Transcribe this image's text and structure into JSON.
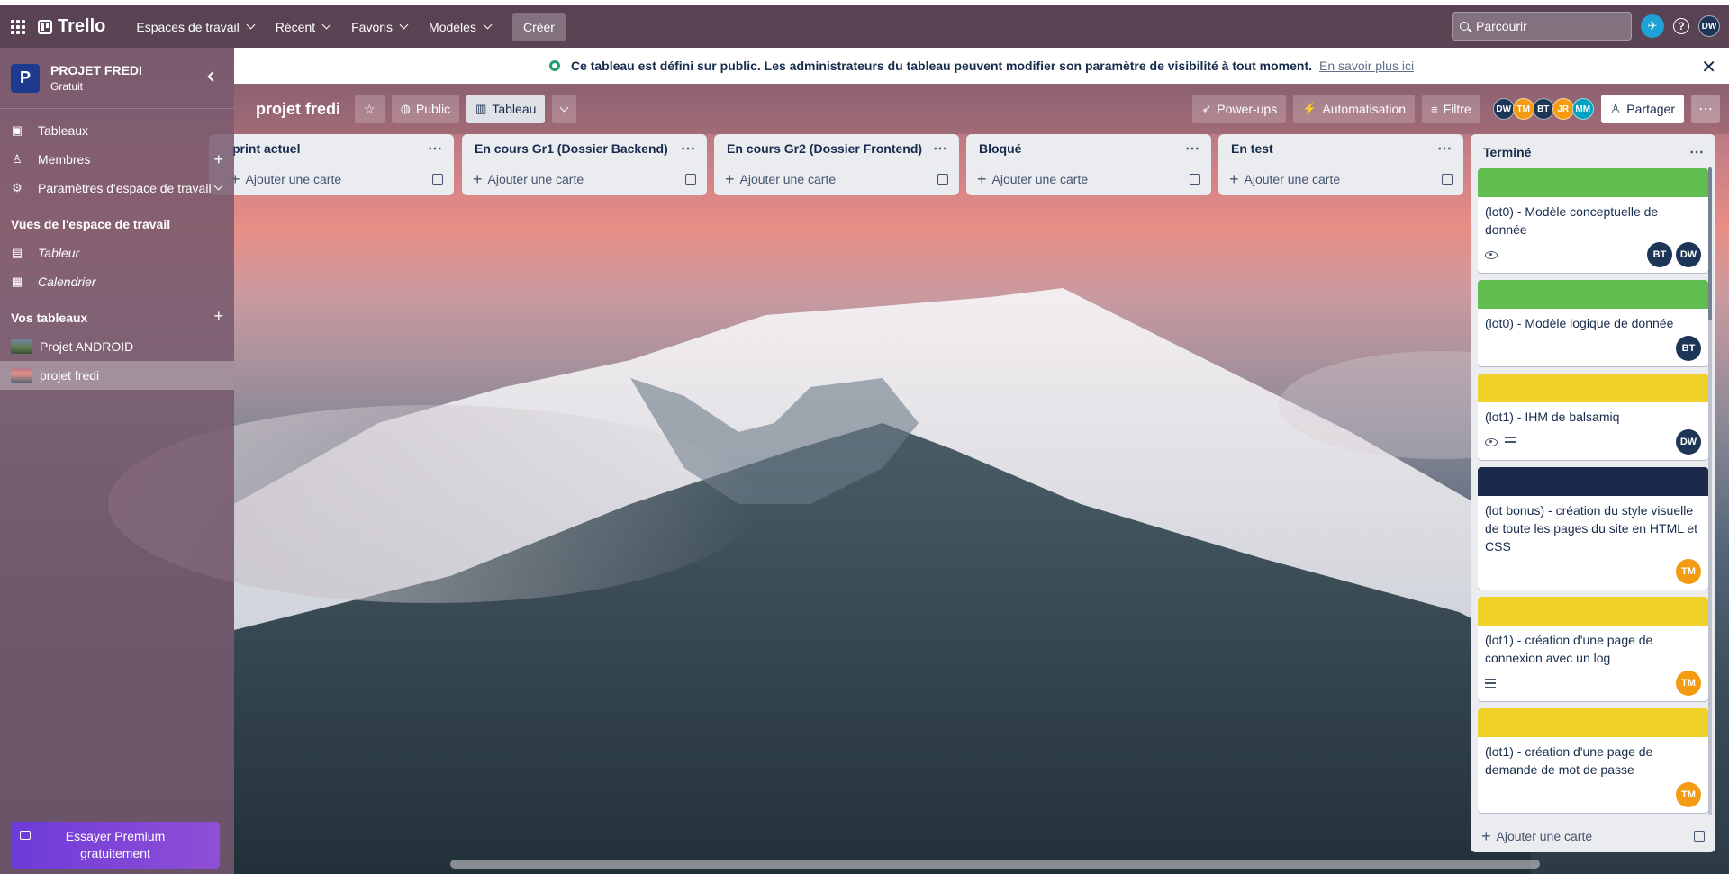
{
  "topbar": {
    "app_name": "Trello",
    "nav": [
      {
        "label": "Espaces de travail"
      },
      {
        "label": "Récent"
      },
      {
        "label": "Favoris"
      },
      {
        "label": "Modèles"
      }
    ],
    "create_label": "Créer",
    "search_placeholder": "Parcourir",
    "user_initials": "DW",
    "help_glyph": "?",
    "icons": [
      "grid-icon",
      "search-icon",
      "notification-icon",
      "help-icon"
    ]
  },
  "sidebar": {
    "workspace_initial": "P",
    "workspace_name": "PROJET FREDI",
    "workspace_plan": "Gratuit",
    "items": [
      {
        "label": "Tableaux",
        "icon": "board-icon"
      },
      {
        "label": "Membres",
        "icon": "person-icon"
      },
      {
        "label": "Paramètres d'espace de travail",
        "icon": "gear-icon"
      }
    ],
    "views_title": "Vues de l'espace de travail",
    "views": [
      {
        "label": "Tableur",
        "icon": "table-icon"
      },
      {
        "label": "Calendrier",
        "icon": "calendar-icon"
      }
    ],
    "boards_title": "Vos tableaux",
    "boards": [
      {
        "label": "Projet ANDROID"
      },
      {
        "label": "projet fredi"
      }
    ],
    "premium_label": "Essayer Premium gratuitement"
  },
  "notice": {
    "text": "Ce tableau est défini sur public. Les administrateurs du tableau peuvent modifier son paramètre de visibilité à tout moment.",
    "link": "En savoir plus ici"
  },
  "board": {
    "title": "projet fredi",
    "visibility": "Public",
    "view": "Tableau",
    "powerups": "Power-ups",
    "automation": "Automatisation",
    "filter": "Filtre",
    "share": "Partager",
    "members": [
      "DW",
      "TM",
      "BT",
      "JR",
      "MM"
    ]
  },
  "lists": [
    {
      "title": "print actuel",
      "add": "Ajouter une carte"
    },
    {
      "title": "En cours Gr1 (Dossier Backend)",
      "add": "Ajouter une carte"
    },
    {
      "title": "En cours Gr2 (Dossier Frontend)",
      "add": "Ajouter une carte"
    },
    {
      "title": "Bloqué",
      "add": "Ajouter une carte"
    },
    {
      "title": "En test",
      "add": "Ajouter une carte"
    },
    {
      "title": "Terminé",
      "add": "Ajouter une carte"
    }
  ],
  "done_cards": [
    {
      "cover": "#61bd4f",
      "title": "(lot0) - Modèle conceptuelle de donnée",
      "members": [
        "BT",
        "DW"
      ],
      "badges": [
        "eye"
      ]
    },
    {
      "cover": "#61bd4f",
      "title": "(lot0) - Modèle logique de donnée",
      "members": [
        "BT"
      ],
      "badges": []
    },
    {
      "cover": "#f0d12a",
      "title": "(lot1) - IHM de balsamiq",
      "members": [
        "DW"
      ],
      "badges": [
        "eye",
        "description"
      ]
    },
    {
      "cover": "#1b2a4a",
      "title": "(lot bonus) - création du style visuelle de toute les pages du site en HTML et CSS",
      "members": [
        "TM"
      ],
      "badges": []
    },
    {
      "cover": "#f0d12a",
      "title": "(lot1) - création d'une page de connexion avec un log",
      "members": [
        "TM"
      ],
      "badges": [
        "description"
      ]
    },
    {
      "cover": "#f0d12a",
      "title": "(lot1) - création d'une page de demande de mot de passe",
      "members": [
        "TM"
      ],
      "badges": []
    }
  ]
}
